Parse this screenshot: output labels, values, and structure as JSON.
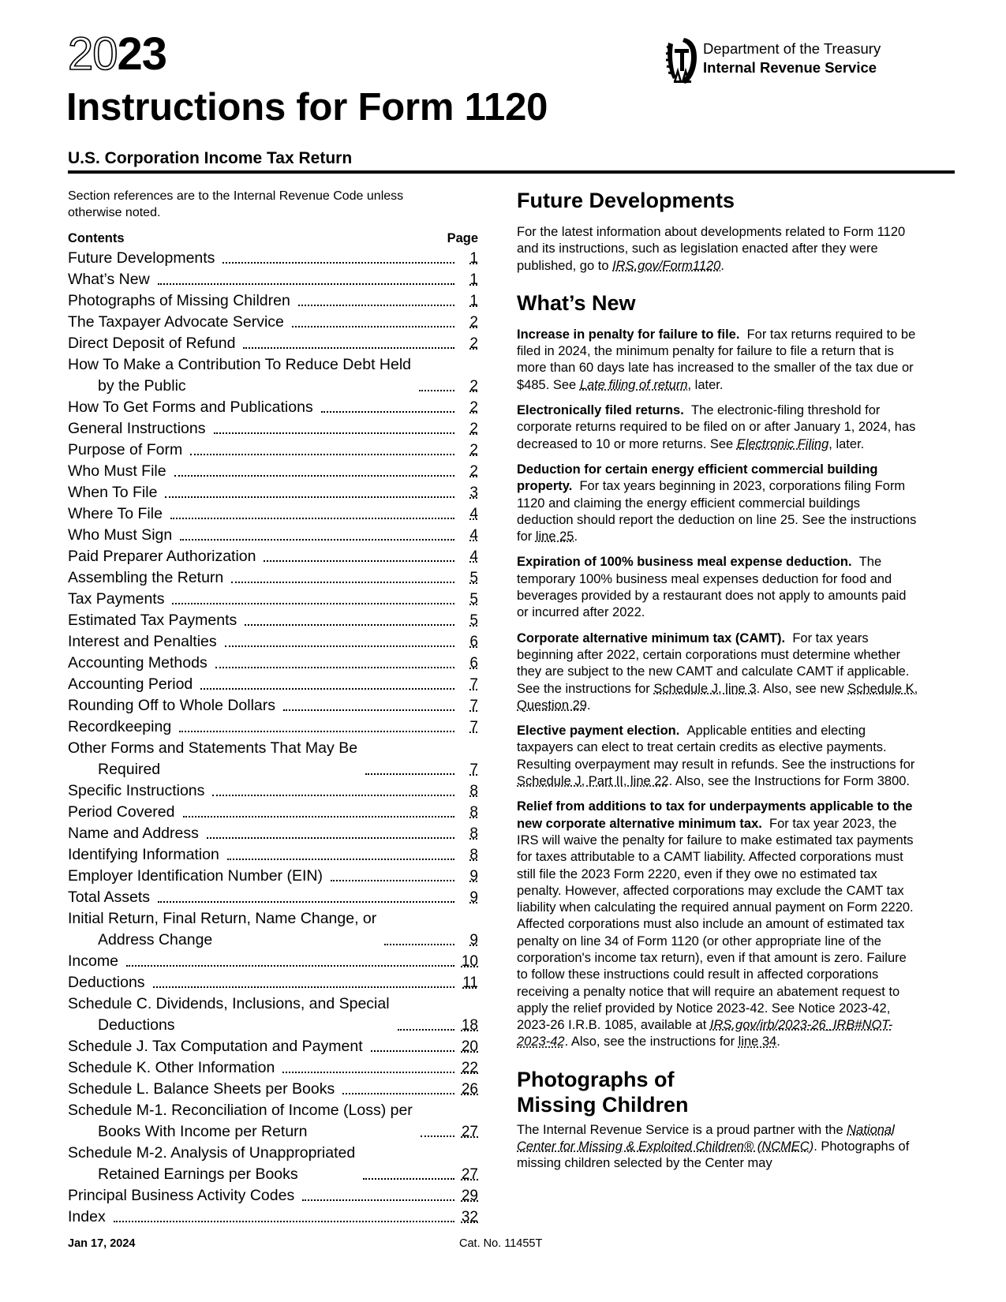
{
  "header": {
    "year_light": "20",
    "year_bold": "23",
    "title": "Instructions for Form 1120",
    "subtitle": "U.S. Corporation Income Tax Return",
    "agency_line1": "Department of the Treasury",
    "agency_line2": "Internal Revenue Service",
    "logo_icon": "irs-eagle-logo-icon"
  },
  "left": {
    "intro": "Section references are to the Internal Revenue Code unless otherwise noted.",
    "toc_header": "Contents",
    "toc_page_header": "Page",
    "toc": [
      {
        "label": "Future Developments",
        "page": "1"
      },
      {
        "label": "What’s New",
        "page": "1"
      },
      {
        "label": "Photographs of Missing Children",
        "page": "1"
      },
      {
        "label": "The Taxpayer Advocate Service",
        "page": "2"
      },
      {
        "label": "Direct Deposit of Refund",
        "page": "2"
      },
      {
        "label": "How To Make a Contribution To Reduce Debt Held",
        "cont": "by the Public",
        "page": "2"
      },
      {
        "label": "How To Get Forms and Publications",
        "page": "2"
      },
      {
        "label": "General Instructions",
        "page": "2"
      },
      {
        "label": "Purpose of Form",
        "page": "2"
      },
      {
        "label": "Who Must File",
        "page": "2"
      },
      {
        "label": "When To File",
        "page": "3"
      },
      {
        "label": "Where To File",
        "page": "4"
      },
      {
        "label": "Who Must Sign",
        "page": "4"
      },
      {
        "label": "Paid Preparer Authorization",
        "page": "4"
      },
      {
        "label": "Assembling the Return",
        "page": "5"
      },
      {
        "label": "Tax Payments",
        "page": "5"
      },
      {
        "label": "Estimated Tax Payments",
        "page": "5"
      },
      {
        "label": "Interest and Penalties",
        "page": "6"
      },
      {
        "label": "Accounting Methods",
        "page": "6"
      },
      {
        "label": "Accounting Period",
        "page": "7"
      },
      {
        "label": "Rounding Off to Whole Dollars",
        "page": "7"
      },
      {
        "label": "Recordkeeping",
        "page": "7"
      },
      {
        "label": "Other Forms and Statements That May Be",
        "cont": "Required",
        "page": "7"
      },
      {
        "label": "Specific Instructions",
        "page": "8"
      },
      {
        "label": "Period Covered",
        "page": "8"
      },
      {
        "label": "Name and Address",
        "page": "8"
      },
      {
        "label": "Identifying Information",
        "page": "8"
      },
      {
        "label": "Employer Identification Number (EIN)",
        "page": "9"
      },
      {
        "label": "Total Assets",
        "page": "9"
      },
      {
        "label": "Initial Return, Final Return, Name Change, or",
        "cont": "Address Change",
        "page": "9"
      },
      {
        "label": "Income",
        "page": "10"
      },
      {
        "label": "Deductions",
        "page": "11"
      },
      {
        "label": "Schedule C. Dividends, Inclusions, and Special",
        "cont": "Deductions",
        "page": "18"
      },
      {
        "label": "Schedule J. Tax Computation and Payment",
        "page": "20"
      },
      {
        "label": "Schedule K. Other Information",
        "page": "22"
      },
      {
        "label": "Schedule L. Balance Sheets per Books",
        "page": "26"
      },
      {
        "label": "Schedule M-1. Reconciliation of Income (Loss) per",
        "cont": "Books With Income per Return",
        "page": "27"
      },
      {
        "label": "Schedule M-2. Analysis of Unappropriated",
        "cont": "Retained Earnings per Books",
        "page": "27"
      },
      {
        "label": "Principal Business Activity Codes",
        "page": "29"
      },
      {
        "label": "Index",
        "page": "32"
      }
    ]
  },
  "right": {
    "future": {
      "heading": "Future Developments",
      "text_before": "For the latest information about developments related to Form 1120 and its instructions, such as legislation enacted after they were published, go to ",
      "link": "IRS.gov/Form1120",
      "text_after": "."
    },
    "whats_new": {
      "heading": "What’s New",
      "items": [
        {
          "title": "Increase in penalty for failure to file.",
          "text": "For tax returns required to be filed in 2024, the minimum penalty for failure to file a return that is more than 60 days late has increased to the smaller of the tax due or $485. See ",
          "link": "Late filing of return",
          "after": ", later."
        },
        {
          "title": "Electronically filed returns.",
          "text": "The electronic-filing threshold for corporate returns required to be filed on or after January 1, 2024, has decreased to 10 or more returns. See ",
          "link": "Electronic Filing",
          "after": ", later."
        },
        {
          "title": "Deduction for certain energy efficient commercial building property.",
          "text": "For tax years beginning in 2023, corporations filing Form 1120 and claiming the energy efficient commercial buildings deduction should report the deduction on line 25. See the instructions for ",
          "link": "line 25",
          "after": "."
        },
        {
          "title": "Expiration of 100% business meal expense deduction.",
          "text": "The temporary 100% business meal expenses deduction for food and beverages provided by a restaurant does not apply to amounts paid or incurred after 2022.",
          "link": "",
          "after": ""
        },
        {
          "title": "Corporate alternative minimum tax (CAMT).",
          "text": "For tax years beginning after 2022, certain corporations must determine whether they are subject to the new CAMT and calculate CAMT if applicable. See the instructions for ",
          "link": "Schedule J, line 3",
          "after": ". Also, see new ",
          "link2": "Schedule K, Question 29",
          "after2": "."
        },
        {
          "title": "Elective payment election.",
          "text": "Applicable entities and electing taxpayers can elect to treat certain credits as elective payments. Resulting overpayment may result in refunds. See the instructions for ",
          "link": "Schedule J, Part II, line 22",
          "after": ". Also, see the Instructions for Form 3800."
        },
        {
          "title": "Relief from additions to tax for underpayments applicable to the new corporate alternative minimum tax.",
          "text": "For tax year 2023, the IRS will waive the penalty for failure to make estimated tax payments for taxes attributable to a CAMT liability. Affected corporations must still file the 2023 Form 2220, even if they owe no estimated tax penalty. However, affected corporations may exclude the CAMT tax liability when calculating the required annual payment on Form 2220. Affected corporations must also include an amount of estimated tax penalty on line 34 of Form 1120 (or other appropriate line of the corporation's income tax return), even if that amount is zero. Failure to follow these instructions could result in affected corporations receiving a penalty notice that will require an abatement request to apply the relief provided by Notice 2023-42. See Notice 2023-42, 2023-26 I.R.B. 1085, available at ",
          "link": "IRS.gov/irb/2023-26_IRB#NOT-2023-42",
          "after": ". Also, see the instructions for ",
          "link2": "line 34",
          "after2": "."
        }
      ]
    },
    "photos": {
      "heading_line1": "Photographs of",
      "heading_line2": "Missing Children",
      "text_before": "The Internal Revenue Service is a proud partner with the ",
      "link": "National Center for Missing & Exploited Children® (NCMEC)",
      "text_after": ". Photographs of missing children selected by the Center may"
    }
  },
  "footer": {
    "date": "Jan 17, 2024",
    "catalog": "Cat. No. 11455T"
  }
}
